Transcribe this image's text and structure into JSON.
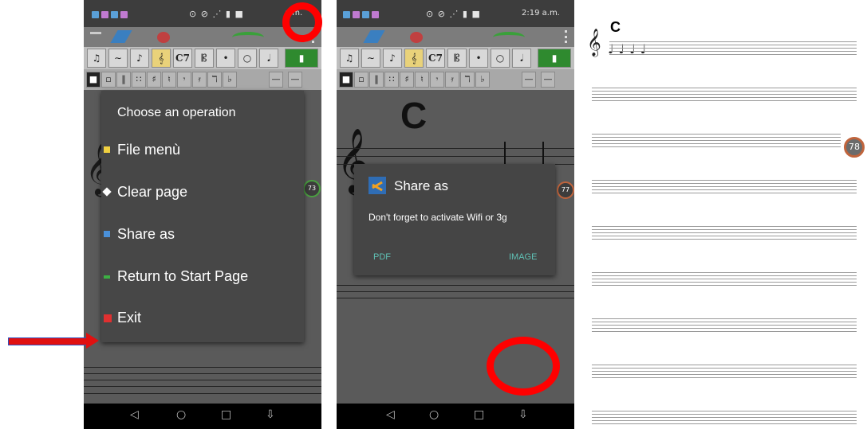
{
  "panel1": {
    "status_right": "a.m.",
    "menu": {
      "title": "Choose an operation",
      "items": [
        {
          "label": "File menù",
          "icon": "folder-icon",
          "color": "#f0d040"
        },
        {
          "label": "Clear page",
          "icon": "eraser-icon",
          "color": "#ffffff"
        },
        {
          "label": "Share as",
          "icon": "share-icon",
          "color": "#4a90d9"
        },
        {
          "label": "Return to Start Page",
          "icon": "back-arrow-icon",
          "color": "#3cb043"
        },
        {
          "label": "Exit",
          "icon": "exit-icon",
          "color": "#e03030"
        }
      ]
    }
  },
  "panel2": {
    "status_right": "2:19 a.m.",
    "chord": "C",
    "dialog": {
      "title": "Share as",
      "message": "Don't forget to activate Wifi or 3g",
      "buttons": [
        "PDF",
        "IMAGE"
      ]
    },
    "badge": "77"
  },
  "panel1_badge": "73",
  "score": {
    "chord": "C",
    "page_badge": "78"
  },
  "toolbar": {
    "chord_symbol": "C7",
    "buttons": [
      "♫",
      "∼",
      "♪",
      "𝄞",
      "C7",
      "𝄡",
      "•",
      "○",
      "𝅘𝅥",
      "▮"
    ]
  },
  "colors": {
    "annotation_red": "#ff0000",
    "accent_teal": "#5fc0b4"
  }
}
